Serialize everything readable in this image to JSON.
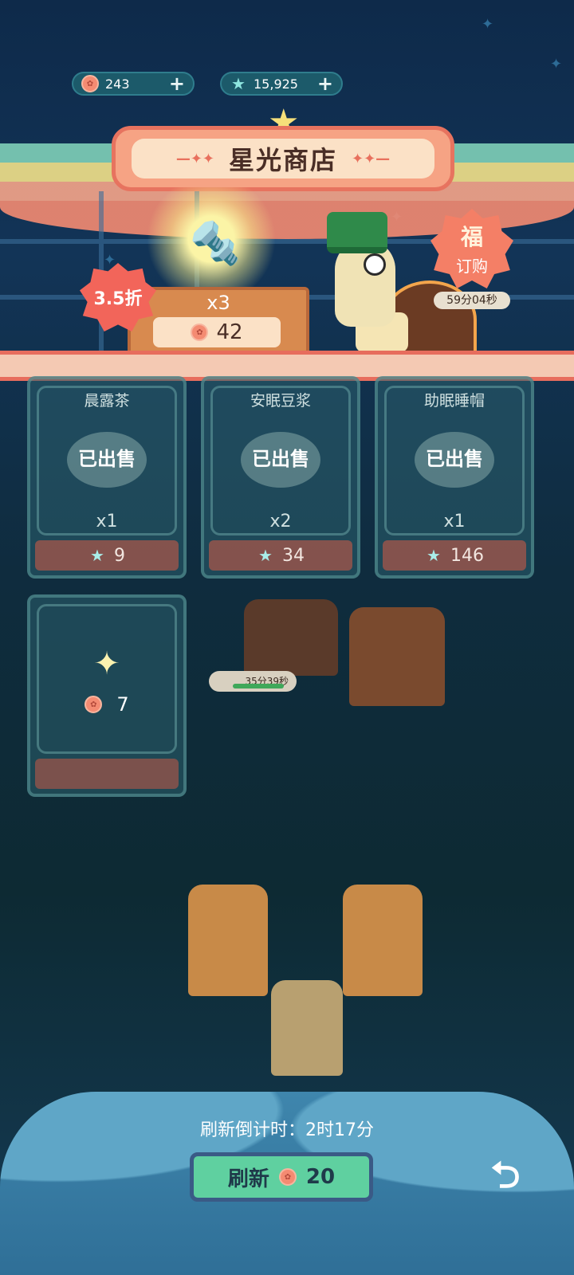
{
  "currency": {
    "flowers": "243",
    "stars": "15,925",
    "add_glyph": "+"
  },
  "shop": {
    "title": "星光商店",
    "title_deco": "—✦✦"
  },
  "featured": {
    "discount": "3.5折",
    "quantity": "x3",
    "price": "42",
    "icon": "bolt-icon"
  },
  "order": {
    "glyph": "福",
    "label": "订购",
    "timer": "59分04秒"
  },
  "products": [
    {
      "name": "晨露茶",
      "status": "已出售",
      "qty": "x1",
      "price": "9"
    },
    {
      "name": "安眠豆浆",
      "status": "已出售",
      "qty": "x2",
      "price": "34"
    },
    {
      "name": "助眠睡帽",
      "status": "已出售",
      "qty": "x1",
      "price": "146"
    }
  ],
  "mystery": {
    "spark": "✦",
    "price": "7"
  },
  "background": {
    "timer": "35分39秒"
  },
  "refresh": {
    "countdown": "刷新倒计时：2时17分",
    "label": "刷新",
    "cost": "20"
  },
  "back": {
    "glyph": "⮌"
  },
  "colors": {
    "accent": "#f48b72",
    "refresh_button": "#5fd0a0",
    "banner": "#f6a384"
  }
}
